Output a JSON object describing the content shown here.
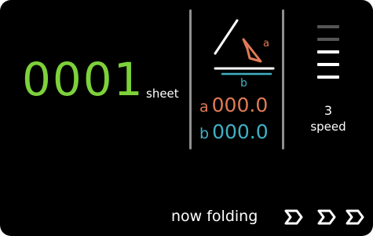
{
  "counter": {
    "value": "0001",
    "unit": "sheet"
  },
  "angles": {
    "a": {
      "label": "a",
      "value": "000.0"
    },
    "b": {
      "label": "b",
      "value": "000.0"
    }
  },
  "speed": {
    "value": "3",
    "label": "speed",
    "levels_total": 5,
    "level": 3
  },
  "status": {
    "text": "now folding"
  },
  "icons": {
    "arrows": [
      "fold-arrow-icon",
      "fold-arrow-icon",
      "fold-arrow-icon"
    ],
    "diagram": "fold-angle-icon"
  },
  "colors": {
    "background": "#000000",
    "counter": "#7dd13a",
    "angle_a": "#e07a56",
    "angle_b": "#3fb0c5",
    "text": "#ffffff",
    "bar_active": "#ffffff",
    "bar_inactive": "#555555",
    "divider": "#8f8f8f"
  }
}
